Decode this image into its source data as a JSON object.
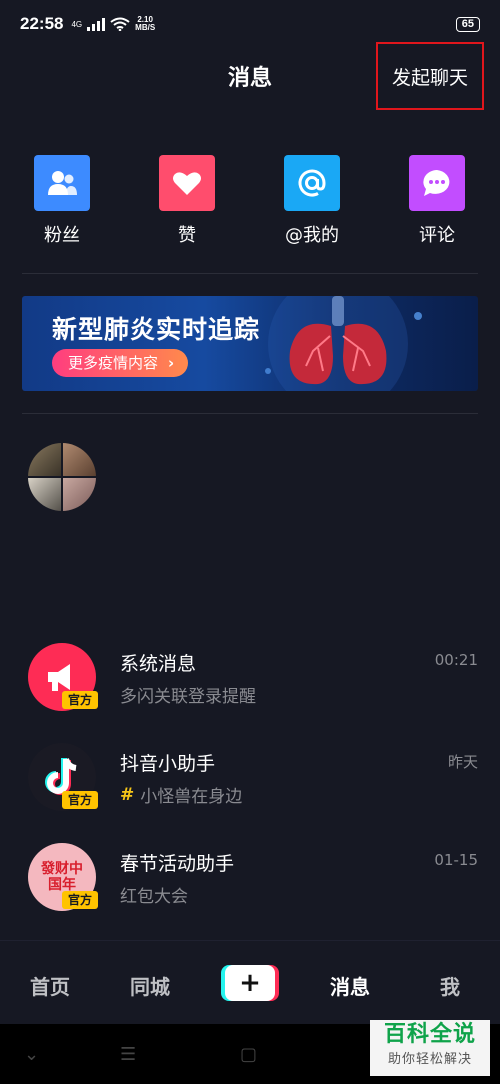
{
  "status_bar": {
    "time": "22:58",
    "network": "4G",
    "speed_value": "2.10",
    "speed_unit": "MB/S",
    "battery": "65"
  },
  "header": {
    "title": "消息",
    "start_chat": "发起聊天"
  },
  "quick_actions": [
    {
      "label": "粉丝",
      "icon": "fans-icon",
      "color": "#3d8bff"
    },
    {
      "label": "赞",
      "icon": "heart-icon",
      "color": "#ff4d6d"
    },
    {
      "label": "@我的",
      "icon": "at-icon",
      "color": "#1aa8f5"
    },
    {
      "label": "评论",
      "icon": "comment-icon",
      "color": "#c24dff"
    }
  ],
  "banner": {
    "title": "新型肺炎实时追踪",
    "button": "更多疫情内容",
    "arrow": "›"
  },
  "messages": [
    {
      "title": "系统消息",
      "subtitle": "多闪关联登录提醒",
      "time": "00:21",
      "badge": "官方"
    },
    {
      "title": "抖音小助手",
      "subtitle": "小怪兽在身边",
      "time": "昨天",
      "badge": "官方",
      "hash": "#"
    },
    {
      "title": "春节活动助手",
      "subtitle": "红包大会",
      "time": "01-15",
      "badge": "官方",
      "avatar_text": "發财中国年"
    }
  ],
  "tabbar": {
    "home": "首页",
    "city": "同城",
    "plus": "+",
    "messages": "消息",
    "me": "我"
  },
  "watermark": {
    "title": "百科全说",
    "subtitle": "助你轻松解决"
  }
}
